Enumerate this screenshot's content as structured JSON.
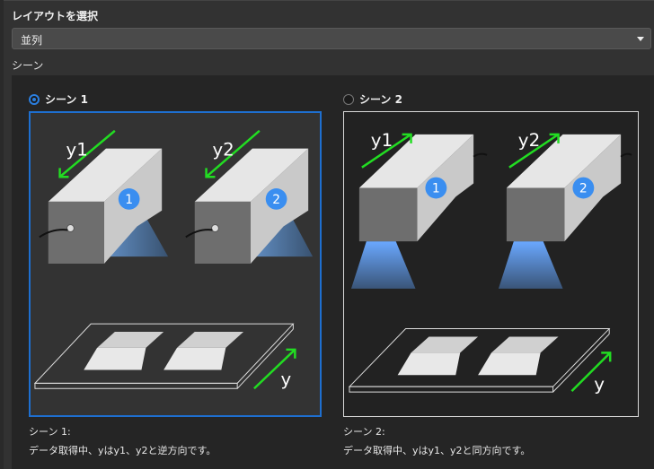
{
  "header": {
    "title": "レイアウトを選択"
  },
  "layout_select": {
    "value": "並列"
  },
  "section": {
    "label": "シーン"
  },
  "scenes": [
    {
      "radio_label": "シーン 1",
      "selected": true,
      "caption_title": "シーン 1:",
      "caption_text": "データ取得中、yはy1、y2と逆方向です。",
      "labels": {
        "y1": "y1",
        "y2": "y2",
        "y": "y",
        "cam1": "1",
        "cam2": "2"
      }
    },
    {
      "radio_label": "シーン 2",
      "selected": false,
      "caption_title": "シーン 2:",
      "caption_text": "データ取得中、yはy1、y2と同方向です。",
      "labels": {
        "y1": "y1",
        "y2": "y2",
        "y": "y",
        "cam1": "1",
        "cam2": "2"
      }
    }
  ],
  "colors": {
    "accent": "#1e6fd0",
    "arrow": "#22dd22",
    "badge": "#3a8ef0"
  }
}
